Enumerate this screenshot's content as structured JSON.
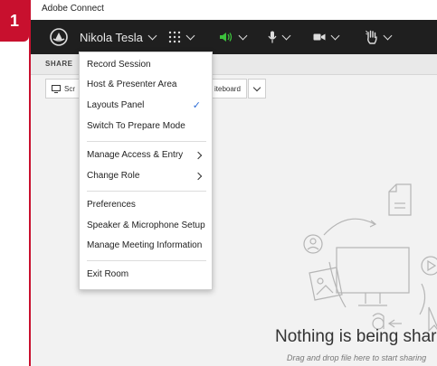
{
  "badge": "1",
  "window_title": "Adobe Connect",
  "toolbar": {
    "user_name": "Nikola Tesla",
    "icons": [
      "adobe-connect-logo-icon",
      "apps-grid-icon",
      "speaker-icon",
      "microphone-icon",
      "camera-icon",
      "raise-hand-icon"
    ]
  },
  "share": {
    "label": "SHARE",
    "screen_partial": "Scr",
    "whiteboard_partial": "iteboard"
  },
  "menu": {
    "items": [
      {
        "label": "Record Session"
      },
      {
        "label": "Host & Presenter Area"
      },
      {
        "label": "Layouts Panel"
      },
      {
        "label": "Switch To Prepare Mode"
      },
      {
        "label": "Manage Access & Entry"
      },
      {
        "label": "Change Role"
      },
      {
        "label": "Preferences"
      },
      {
        "label": "Speaker & Microphone Setup"
      },
      {
        "label": "Manage Meeting Information"
      },
      {
        "label": "Exit Room"
      }
    ]
  },
  "empty_state": {
    "title": "Nothing is being shared",
    "subtitle": "Drag and drop file here to start sharing"
  },
  "colors": {
    "accent": "#c8102e",
    "toolbar": "#1f1f1f",
    "check": "#2c6cd6",
    "speaker": "#3cc03c"
  }
}
